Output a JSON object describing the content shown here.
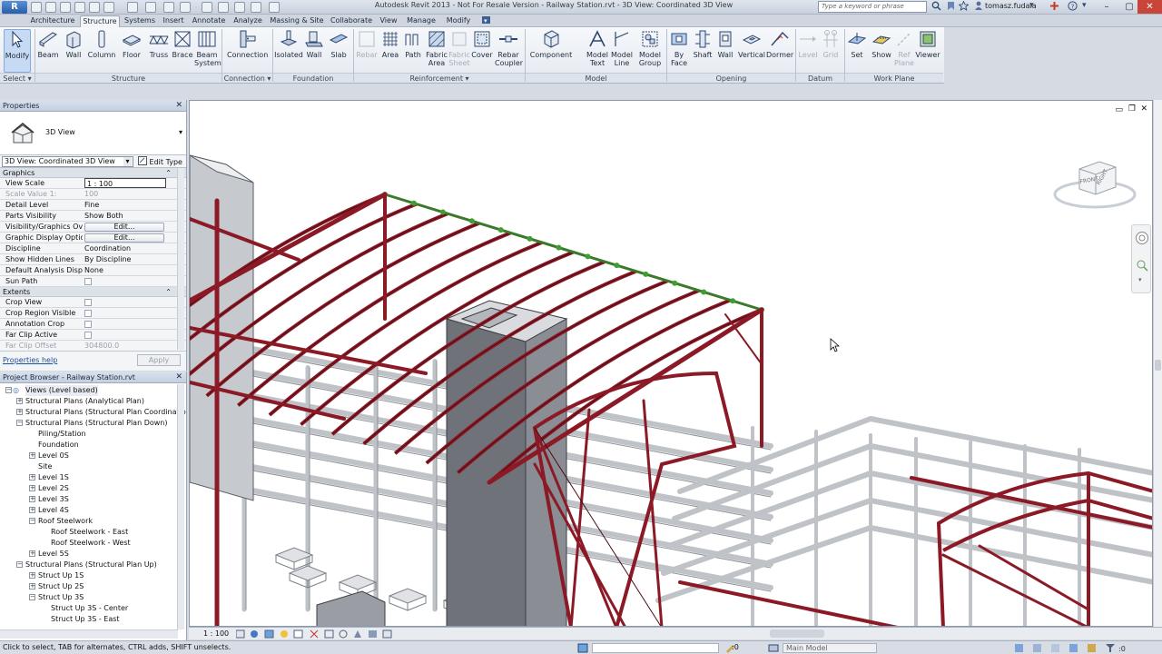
{
  "titlebar": {
    "app_badge": "R",
    "title": "Autodesk Revit 2013 - Not For Resale Version -     Railway Station.rvt - 3D View: Coordinated 3D View",
    "search_placeholder": "Type a keyword or phrase",
    "username": "tomasz.fudala"
  },
  "tabs": [
    "Architecture",
    "Structure",
    "Systems",
    "Insert",
    "Annotate",
    "Analyze",
    "Massing & Site",
    "Collaborate",
    "View",
    "Manage",
    "Modify"
  ],
  "active_tab": "Structure",
  "ribbon": {
    "tools": {
      "modify": "Modify",
      "beam": "Beam",
      "wall": "Wall",
      "column": "Column",
      "floor": "Floor",
      "truss": "Truss",
      "brace": "Brace",
      "beam_system": "Beam System",
      "connection": "Connection",
      "isolated": "Isolated",
      "wall_found": "Wall",
      "slab": "Slab",
      "rebar": "Rebar",
      "area": "Area",
      "path": "Path",
      "fabric_area": "Fabric Area",
      "fabric_sheet": "Fabric Sheet",
      "cover": "Cover",
      "rebar_coupler": "Rebar Coupler",
      "component": "Component",
      "model_text": "Model Text",
      "model_line": "Model Line",
      "model_group": "Model Group",
      "by_face": "By Face",
      "shaft": "Shaft",
      "wall_open": "Wall",
      "vertical": "Vertical",
      "dormer": "Dormer",
      "level": "Level",
      "grid": "Grid",
      "set": "Set",
      "show": "Show",
      "ref_plane": "Ref Plane",
      "viewer": "Viewer"
    },
    "panels": {
      "select": "Select ▾",
      "structure": "Structure",
      "connection": "Connection ▾",
      "foundation": "Foundation",
      "reinforcement": "Reinforcement ▾",
      "model": "Model",
      "opening": "Opening",
      "datum": "Datum",
      "work_plane": "Work Plane"
    }
  },
  "properties": {
    "header": "Properties",
    "type_name": "3D View",
    "instance_selector": "3D View: Coordinated 3D View",
    "edit_type": "Edit Type",
    "groups": {
      "graphics": "Graphics",
      "extents": "Extents"
    },
    "rows": {
      "view_scale": {
        "name": "View Scale",
        "value": "1 : 100"
      },
      "scale_value": {
        "name": "Scale Value    1:",
        "value": "100"
      },
      "detail_level": {
        "name": "Detail Level",
        "value": "Fine"
      },
      "parts_visibility": {
        "name": "Parts Visibility",
        "value": "Show Both"
      },
      "vg_overrides": {
        "name": "Visibility/Graphics Ov...",
        "value": "Edit..."
      },
      "graphic_display": {
        "name": "Graphic Display Options",
        "value": "Edit..."
      },
      "discipline": {
        "name": "Discipline",
        "value": "Coordination"
      },
      "hidden_lines": {
        "name": "Show Hidden Lines",
        "value": "By Discipline"
      },
      "analysis_display": {
        "name": "Default Analysis Displ...",
        "value": "None"
      },
      "sun_path": {
        "name": "Sun Path",
        "value": ""
      },
      "crop_view": {
        "name": "Crop View",
        "value": ""
      },
      "crop_region": {
        "name": "Crop Region Visible",
        "value": ""
      },
      "annotation_crop": {
        "name": "Annotation Crop",
        "value": ""
      },
      "far_clip_active": {
        "name": "Far Clip Active",
        "value": ""
      },
      "far_clip_offset": {
        "name": "Far Clip Offset",
        "value": "304800.0"
      }
    },
    "help_link": "Properties help",
    "apply": "Apply"
  },
  "browser": {
    "header": "Project Browser - Railway Station.rvt",
    "nodes": [
      {
        "label": "Views (Level based)",
        "level": 0,
        "box": "−"
      },
      {
        "label": "Structural Plans (Analytical Plan)",
        "level": 1,
        "box": "+"
      },
      {
        "label": "Structural Plans (Structural Plan Coordination",
        "level": 1,
        "box": "+"
      },
      {
        "label": "Structural Plans (Structural Plan Down)",
        "level": 1,
        "box": "−"
      },
      {
        "label": "Piling/Station",
        "level": 2,
        "box": ""
      },
      {
        "label": "Foundation",
        "level": 2,
        "box": ""
      },
      {
        "label": "Level 0S",
        "level": 2,
        "box": "+"
      },
      {
        "label": "Site",
        "level": 2,
        "box": ""
      },
      {
        "label": "Level 1S",
        "level": 2,
        "box": "+"
      },
      {
        "label": "Level 2S",
        "level": 2,
        "box": "+"
      },
      {
        "label": "Level 3S",
        "level": 2,
        "box": "+"
      },
      {
        "label": "Level 4S",
        "level": 2,
        "box": "+"
      },
      {
        "label": "Roof Steelwork",
        "level": 2,
        "box": "−"
      },
      {
        "label": "Roof Steelwork - East",
        "level": 3,
        "box": ""
      },
      {
        "label": "Roof Steelwork - West",
        "level": 3,
        "box": ""
      },
      {
        "label": "Level 5S",
        "level": 2,
        "box": "+"
      },
      {
        "label": "Structural Plans (Structural Plan Up)",
        "level": 1,
        "box": "−"
      },
      {
        "label": "Struct Up 1S",
        "level": 2,
        "box": "+"
      },
      {
        "label": "Struct Up 2S",
        "level": 2,
        "box": "+"
      },
      {
        "label": "Struct Up 3S",
        "level": 2,
        "box": "−"
      },
      {
        "label": "Struct Up 3S - Center",
        "level": 3,
        "box": ""
      },
      {
        "label": "Struct Up 3S - East",
        "level": 3,
        "box": ""
      }
    ]
  },
  "viewcube": {
    "front": "FRONT",
    "right": "RIGHT"
  },
  "viewbar": {
    "scale": "1 : 100"
  },
  "status": {
    "message": "Click to select, TAB for alternates, CTRL adds, SHIFT unselects.",
    "coord_zero": ":0",
    "model": "Main Model"
  },
  "colors": {
    "steel": "#8b1a26",
    "concrete": "#bfc2c6",
    "purlin": "#3a7a2a",
    "ribbon_bg": "#eef1f5"
  }
}
